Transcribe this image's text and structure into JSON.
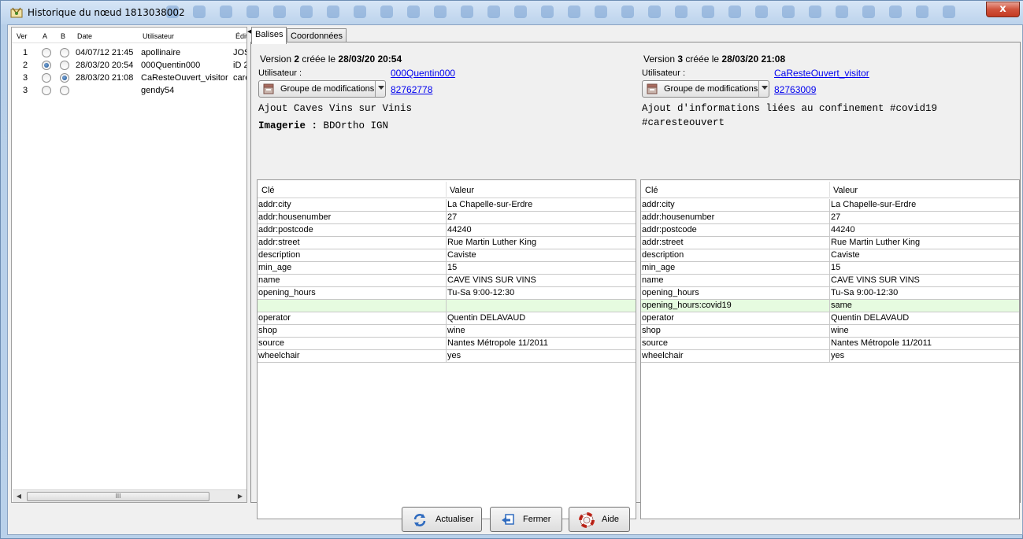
{
  "window": {
    "title": "Historique du nœud 1813038002",
    "close_label": "x"
  },
  "history": {
    "columns": [
      "Ver",
      "A",
      "B",
      "Date",
      "Utilisateur",
      "Édit"
    ],
    "rows": [
      {
        "ver": "1",
        "a": false,
        "b": false,
        "date": "04/07/12 21:45",
        "user": "apollinaire",
        "editor": "JOS"
      },
      {
        "ver": "2",
        "a": true,
        "b": false,
        "date": "28/03/20 20:54",
        "user": "000Quentin000",
        "editor": "iD 2"
      },
      {
        "ver": "3",
        "a": false,
        "b": true,
        "date": "28/03/20 21:08",
        "user": "CaResteOuvert_visitor",
        "editor": "care"
      },
      {
        "ver": "3",
        "a": false,
        "b": false,
        "date": "",
        "user": "gendy54",
        "editor": ""
      }
    ],
    "scrollbar_grip": "III"
  },
  "tabs": {
    "tags": "Balises",
    "coords": "Coordonnées"
  },
  "left_version": {
    "title_prefix": "Version ",
    "number": "2",
    "title_mid": " créée le ",
    "datetime": "28/03/20 20:54",
    "user_label": "Utilisateur :",
    "user": "000Quentin000",
    "changeset_button": "Groupe de modifications",
    "changeset_id": "82762778",
    "comment": "Ajout Caves Vins sur Vinis",
    "imagery_label": "Imagerie :",
    "imagery_value": " BDOrtho IGN",
    "table": {
      "key_header": "Clé",
      "value_header": "Valeur",
      "rows": [
        {
          "k": "addr:city",
          "v": "La Chapelle-sur-Erdre",
          "diff": false
        },
        {
          "k": "addr:housenumber",
          "v": "27",
          "diff": false
        },
        {
          "k": "addr:postcode",
          "v": "44240",
          "diff": false
        },
        {
          "k": "addr:street",
          "v": "Rue Martin Luther King",
          "diff": false
        },
        {
          "k": "description",
          "v": "Caviste",
          "diff": false
        },
        {
          "k": "min_age",
          "v": "15",
          "diff": false
        },
        {
          "k": "name",
          "v": "CAVE VINS SUR VINS",
          "diff": false
        },
        {
          "k": "opening_hours",
          "v": "Tu-Sa 9:00-12:30",
          "diff": false
        },
        {
          "k": "",
          "v": "",
          "diff": true
        },
        {
          "k": "operator",
          "v": "Quentin DELAVAUD",
          "diff": false
        },
        {
          "k": "shop",
          "v": "wine",
          "diff": false
        },
        {
          "k": "source",
          "v": "Nantes Métropole 11/2011",
          "diff": false
        },
        {
          "k": "wheelchair",
          "v": "yes",
          "diff": false
        }
      ]
    }
  },
  "right_version": {
    "title_prefix": "Version ",
    "number": "3",
    "title_mid": " créée le ",
    "datetime": "28/03/20 21:08",
    "user_label": "Utilisateur :",
    "user": "CaResteOuvert_visitor",
    "changeset_button": "Groupe de modifications",
    "changeset_id": "82763009",
    "comment_line1": "Ajout d'informations liées au confinement #covid19",
    "comment_line2": "#caresteouvert",
    "table": {
      "key_header": "Clé",
      "value_header": "Valeur",
      "rows": [
        {
          "k": "addr:city",
          "v": "La Chapelle-sur-Erdre",
          "diff": false
        },
        {
          "k": "addr:housenumber",
          "v": "27",
          "diff": false
        },
        {
          "k": "addr:postcode",
          "v": "44240",
          "diff": false
        },
        {
          "k": "addr:street",
          "v": "Rue Martin Luther King",
          "diff": false
        },
        {
          "k": "description",
          "v": "Caviste",
          "diff": false
        },
        {
          "k": "min_age",
          "v": "15",
          "diff": false
        },
        {
          "k": "name",
          "v": "CAVE VINS SUR VINS",
          "diff": false
        },
        {
          "k": "opening_hours",
          "v": "Tu-Sa 9:00-12:30",
          "diff": false
        },
        {
          "k": "opening_hours:covid19",
          "v": "same",
          "diff": true
        },
        {
          "k": "operator",
          "v": "Quentin DELAVAUD",
          "diff": false
        },
        {
          "k": "shop",
          "v": "wine",
          "diff": false
        },
        {
          "k": "source",
          "v": "Nantes Métropole 11/2011",
          "diff": false
        },
        {
          "k": "wheelchair",
          "v": "yes",
          "diff": false
        }
      ]
    }
  },
  "buttons": {
    "refresh": "Actualiser",
    "close": "Fermer",
    "help": "Aide"
  },
  "colors": {
    "diff_row": "#e6fbe0",
    "link": "#0000ee"
  }
}
